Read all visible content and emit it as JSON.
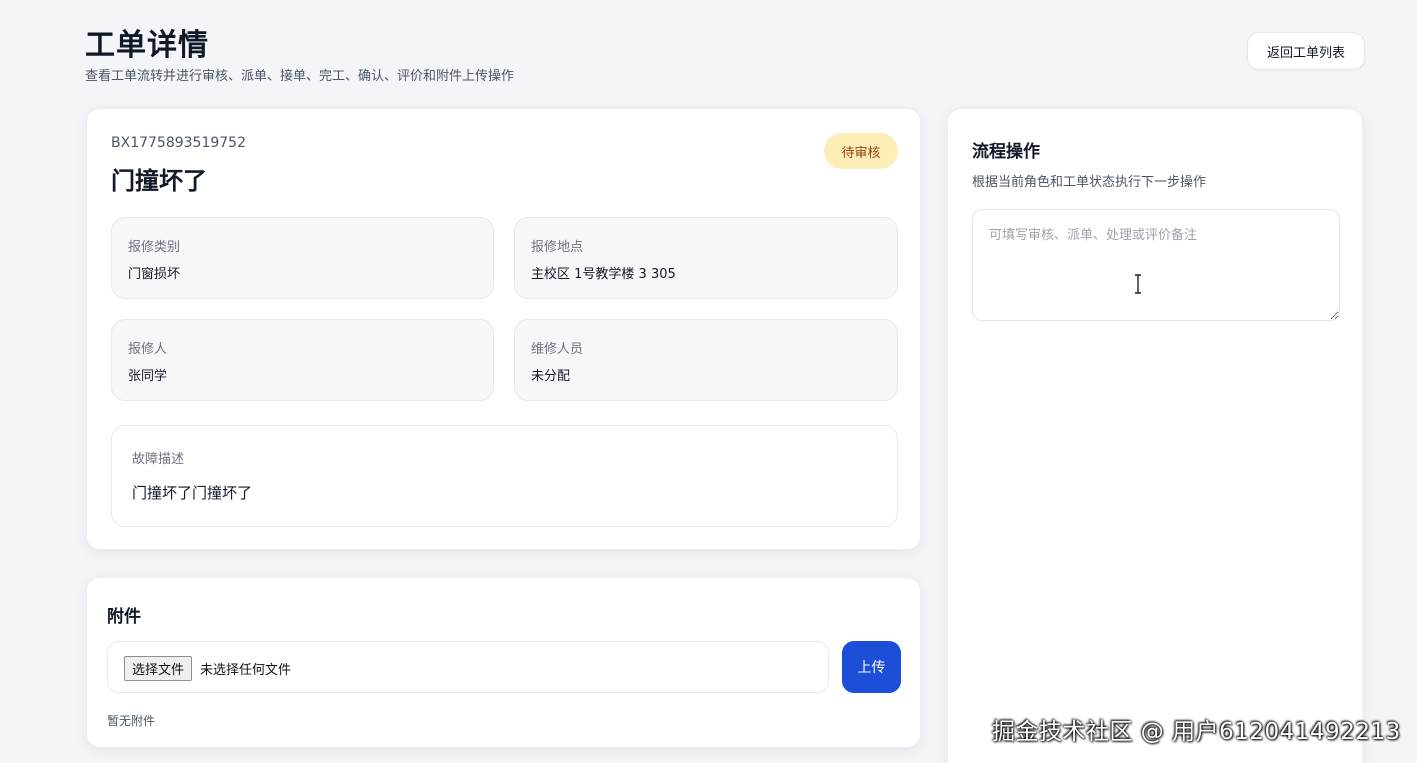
{
  "header": {
    "title": "工单详情",
    "subtitle": "查看工单流转并进行审核、派单、接单、完工、确认、评价和附件上传操作",
    "back_button": "返回工单列表"
  },
  "order": {
    "number": "BX1775893519752",
    "title": "门撞坏了",
    "status": "待审核",
    "fields": {
      "category": {
        "label": "报修类别",
        "value": "门窗损坏"
      },
      "location": {
        "label": "报修地点",
        "value": "主校区 1号教学楼 3 305"
      },
      "reporter": {
        "label": "报修人",
        "value": "张同学"
      },
      "repairer": {
        "label": "维修人员",
        "value": "未分配"
      }
    },
    "description": {
      "label": "故障描述",
      "value": "门撞坏了门撞坏了"
    }
  },
  "attachments": {
    "title": "附件",
    "choose_button": "选择文件",
    "file_status": "未选择任何文件",
    "upload_button": "上传",
    "empty_text": "暂无附件"
  },
  "flow": {
    "title": "流程操作",
    "subtitle": "根据当前角色和工单状态执行下一步操作",
    "remark_placeholder": "可填写审核、派单、处理或评价备注"
  },
  "watermark": "掘金技术社区 @ 用户612041492213",
  "colors": {
    "primary": "#1d4ed8",
    "status_bg": "#fdeeb8",
    "status_text": "#92400e",
    "page_bg": "#f3f5f8"
  }
}
